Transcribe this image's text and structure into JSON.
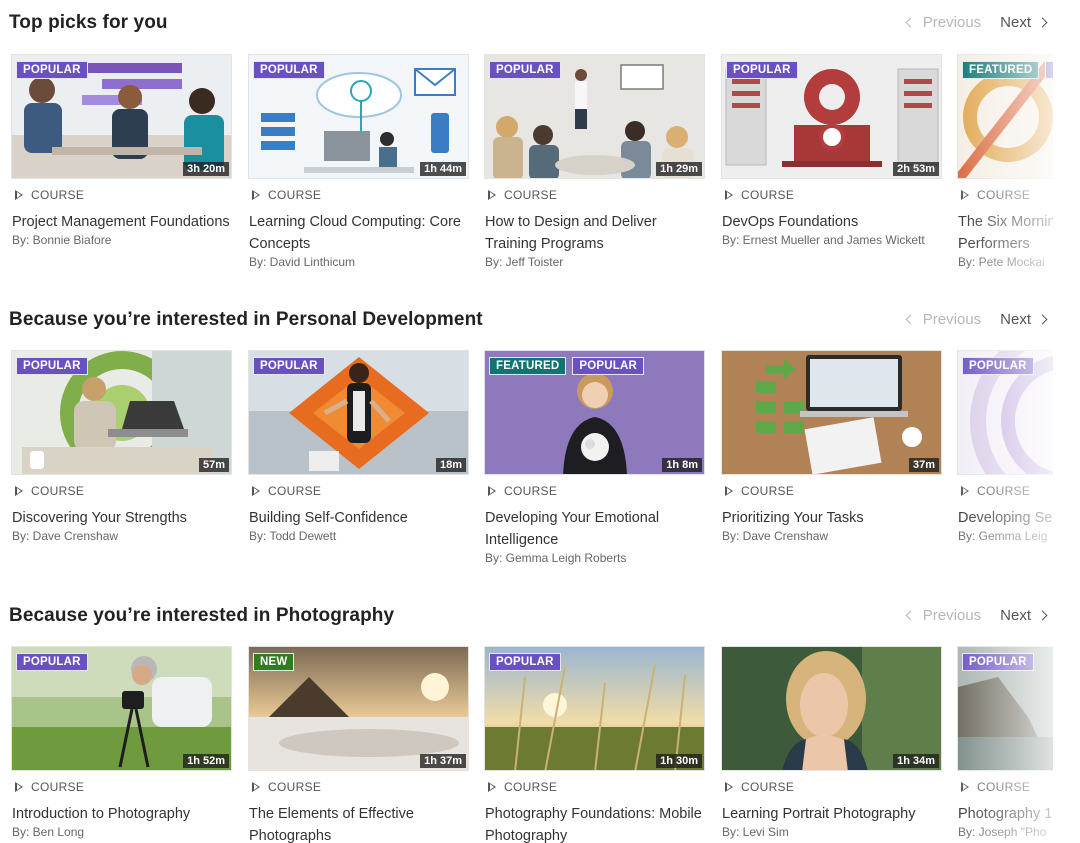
{
  "pager": {
    "previous": "Previous",
    "next": "Next"
  },
  "sections": [
    {
      "title": "Top picks for you",
      "cards": [
        {
          "badges": [
            "POPULAR"
          ],
          "duration": "3h 20m",
          "type": "COURSE",
          "title": "Project Management Foundations",
          "author": "By: Bonnie Biafore"
        },
        {
          "badges": [
            "POPULAR"
          ],
          "duration": "1h 44m",
          "type": "COURSE",
          "title": "Learning Cloud Computing: Core Concepts",
          "author": "By: David Linthicum"
        },
        {
          "badges": [
            "POPULAR"
          ],
          "duration": "1h 29m",
          "type": "COURSE",
          "title": "How to Design and Deliver Training Programs",
          "author": "By: Jeff Toister"
        },
        {
          "badges": [
            "POPULAR"
          ],
          "duration": "2h 53m",
          "type": "COURSE",
          "title": "DevOps Foundations",
          "author": "By: Ernest Mueller and James Wickett"
        },
        {
          "badges": [
            "FEATURED",
            "P"
          ],
          "duration": "",
          "type": "COURSE",
          "title": "The Six Mornin Performers",
          "author": "By: Pete Mockai"
        }
      ]
    },
    {
      "title": "Because you’re interested in Personal Development",
      "cards": [
        {
          "badges": [
            "POPULAR"
          ],
          "duration": "57m",
          "type": "COURSE",
          "title": "Discovering Your Strengths",
          "author": "By: Dave Crenshaw"
        },
        {
          "badges": [
            "POPULAR"
          ],
          "duration": "18m",
          "type": "COURSE",
          "title": "Building Self-Confidence",
          "author": "By: Todd Dewett"
        },
        {
          "badges": [
            "FEATURED",
            "POPULAR"
          ],
          "duration": "1h 8m",
          "type": "COURSE",
          "title": "Developing Your Emotional Intelligence",
          "author": "By: Gemma Leigh Roberts"
        },
        {
          "badges": [],
          "duration": "37m",
          "type": "COURSE",
          "title": "Prioritizing Your Tasks",
          "author": "By: Dave Crenshaw"
        },
        {
          "badges": [
            "POPULAR"
          ],
          "duration": "",
          "type": "COURSE",
          "title": "Developing Sel",
          "author": "By: Gemma Leig"
        }
      ]
    },
    {
      "title": "Because you’re interested in Photography",
      "cards": [
        {
          "badges": [
            "POPULAR"
          ],
          "duration": "1h 52m",
          "type": "COURSE",
          "title": "Introduction to Photography",
          "author": "By: Ben Long"
        },
        {
          "badges": [
            "NEW"
          ],
          "duration": "1h 37m",
          "type": "COURSE",
          "title": "The Elements of Effective Photographs",
          "author": ""
        },
        {
          "badges": [
            "POPULAR"
          ],
          "duration": "1h 30m",
          "type": "COURSE",
          "title": "Photography Foundations: Mobile Photography",
          "author": ""
        },
        {
          "badges": [],
          "duration": "1h 34m",
          "type": "COURSE",
          "title": "Learning Portrait Photography",
          "author": "By: Levi Sim"
        },
        {
          "badges": [
            "POPULAR"
          ],
          "duration": "",
          "type": "COURSE",
          "title": "Photography 1",
          "author": "By: Joseph \"Pho"
        }
      ]
    }
  ]
}
